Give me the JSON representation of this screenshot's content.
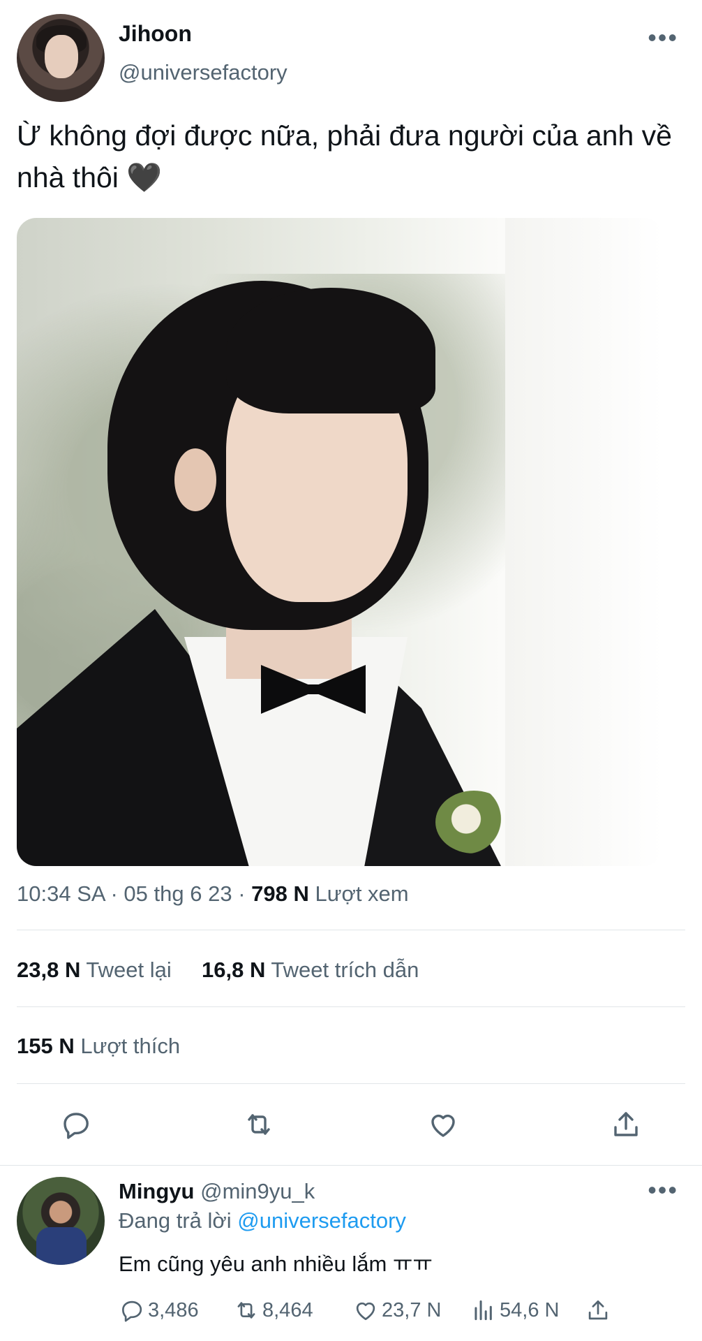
{
  "tweet": {
    "author": {
      "name": "Jihoon",
      "handle": "@universefactory",
      "avatar_icon": "avatar-photo"
    },
    "more_icon": "more-horizontal-icon",
    "more_label": "•••",
    "text": "Ừ không đợi được nữa, phải đưa người của anh về nhà thôi 🖤",
    "media_alt": "photo",
    "meta": {
      "time": "10:34 SA",
      "separator": "·",
      "date": "05 thg 6 23",
      "views_count": "798 N",
      "views_label": "Lượt xem"
    },
    "stats": {
      "retweets_count": "23,8 N",
      "retweets_label": "Tweet lại",
      "quotes_count": "16,8 N",
      "quotes_label": "Tweet trích dẫn",
      "likes_count": "155 N",
      "likes_label": "Lượt thích"
    },
    "actions": [
      "reply-icon",
      "retweet-icon",
      "like-icon",
      "share-icon"
    ]
  },
  "reply": {
    "author": {
      "name": "Mingyu",
      "handle": "@min9yu_k"
    },
    "more_label": "•••",
    "replying_prefix": "Đang trả lời",
    "replying_to": "@universefactory",
    "text": "Em cũng yêu anh nhiều lắm ㅠㅠ",
    "counts": {
      "replies": "3,486",
      "retweets": "8,464",
      "likes": "23,7 N",
      "views": "54,6 N"
    }
  },
  "colors": {
    "text_primary": "#0f1419",
    "text_secondary": "#536471",
    "accent": "#1d9bf0",
    "divider": "#e1e5e8"
  }
}
